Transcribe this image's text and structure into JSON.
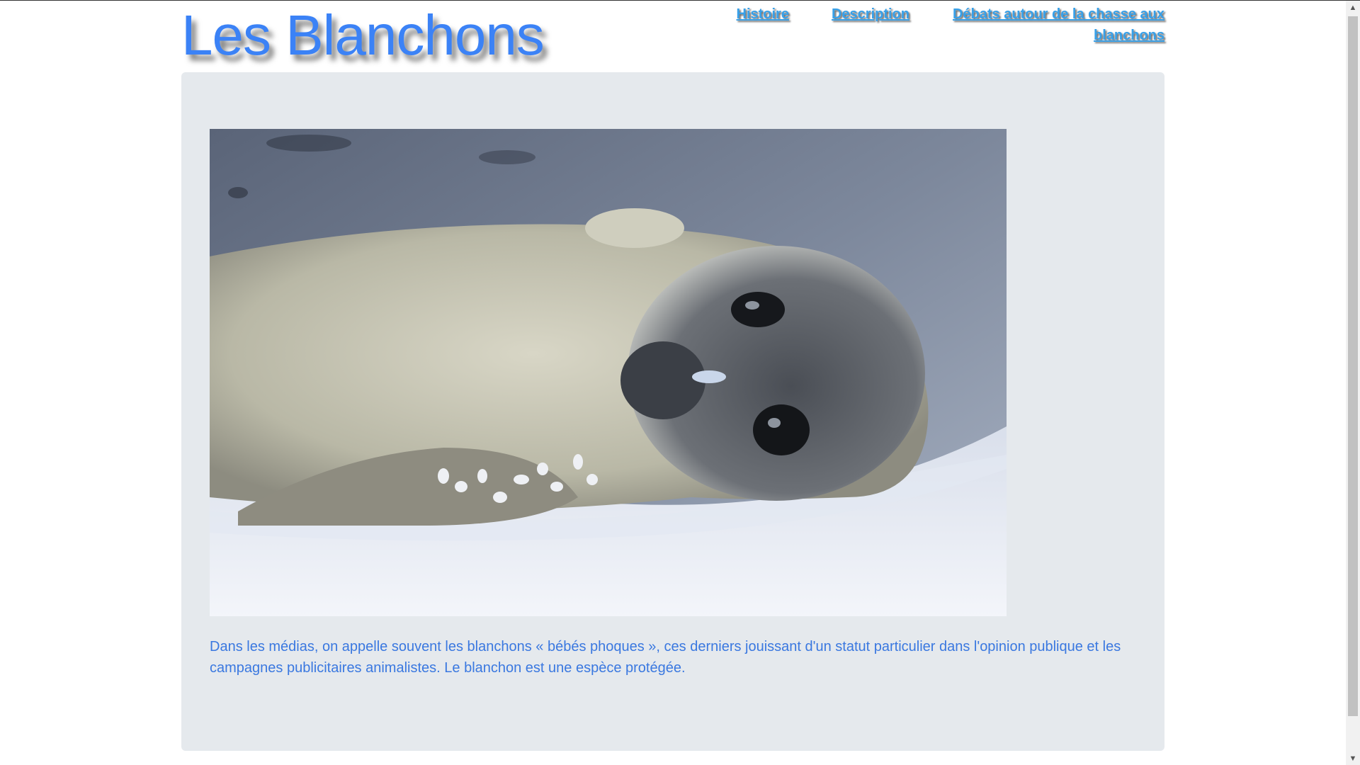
{
  "header": {
    "site_title": "Les Blanchons"
  },
  "nav": {
    "items": [
      {
        "label": "Histoire"
      },
      {
        "label": "Description"
      },
      {
        "label": "Débats autour de la chasse aux blanchons"
      }
    ]
  },
  "main": {
    "image_subject": "baby seal lying on snow",
    "caption": "Dans les médias, on appelle souvent les blanchons « bébés phoques », ces derniers jouissant d'un statut particulier dans l'opinion publique et les campagnes publicitaires animalistes. Le blanchon est une espèce protégée."
  },
  "colors": {
    "title": "#3b82f6",
    "nav_link": "#38a0e8",
    "caption_text": "#3a78e0",
    "card_background": "#e5e9ed"
  }
}
